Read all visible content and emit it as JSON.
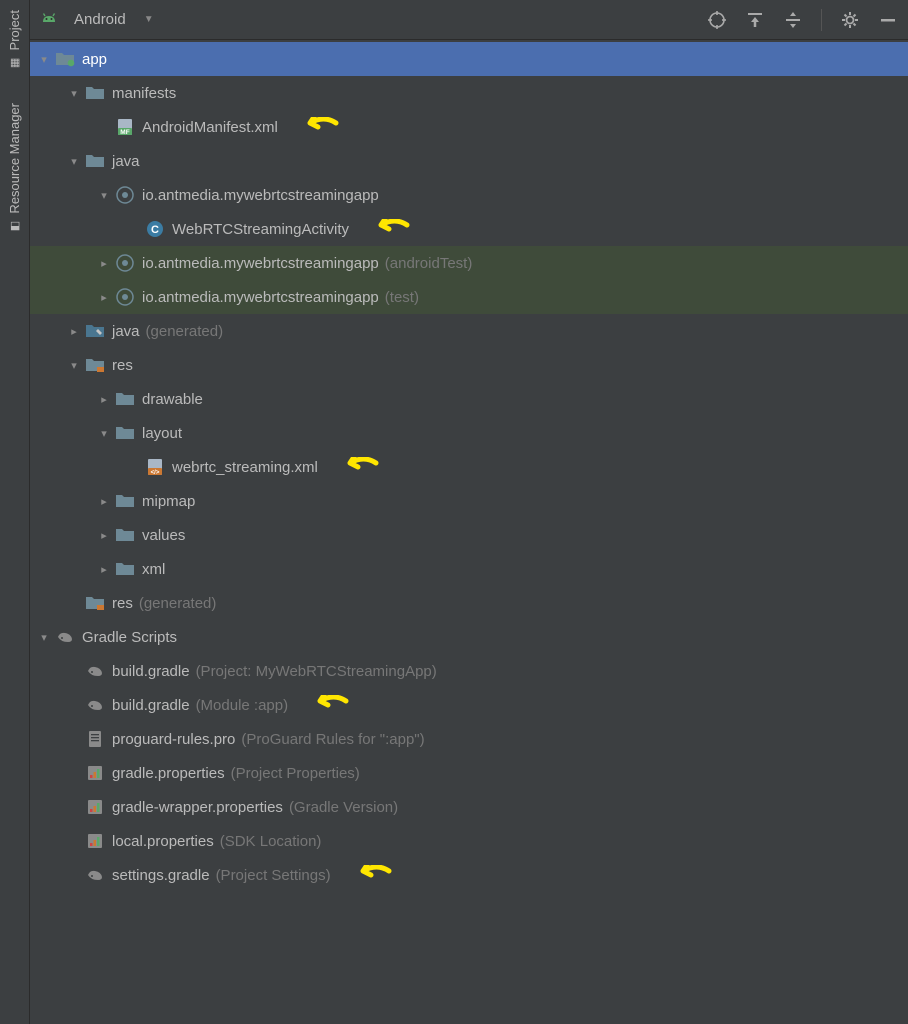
{
  "sideTabs": {
    "project": "Project",
    "resourceManager": "Resource Manager"
  },
  "header": {
    "viewName": "Android"
  },
  "tree": {
    "app": "app",
    "manifests": "manifests",
    "androidManifest": "AndroidManifest.xml",
    "java": "java",
    "pkgMain": "io.antmedia.mywebrtcstreamingapp",
    "activity": "WebRTCStreamingActivity",
    "pkgAndroidTest": "io.antmedia.mywebrtcstreamingapp",
    "pkgAndroidTestSuffix": "(androidTest)",
    "pkgTest": "io.antmedia.mywebrtcstreamingapp",
    "pkgTestSuffix": "(test)",
    "javaGen": "java",
    "javaGenSuffix": "(generated)",
    "res": "res",
    "drawable": "drawable",
    "layout": "layout",
    "layoutFile": "webrtc_streaming.xml",
    "mipmap": "mipmap",
    "values": "values",
    "xml": "xml",
    "resGen": "res",
    "resGenSuffix": "(generated)",
    "gradleScripts": "Gradle Scripts",
    "buildGradleProj": "build.gradle",
    "buildGradleProjSuffix": "(Project: MyWebRTCStreamingApp)",
    "buildGradleMod": "build.gradle",
    "buildGradleModSuffix": "(Module :app)",
    "proguard": "proguard-rules.pro",
    "proguardSuffix": "(ProGuard Rules for \":app\")",
    "gradleProps": "gradle.properties",
    "gradlePropsSuffix": "(Project Properties)",
    "wrapperProps": "gradle-wrapper.properties",
    "wrapperPropsSuffix": "(Gradle Version)",
    "localProps": "local.properties",
    "localPropsSuffix": "(SDK Location)",
    "settingsGradle": "settings.gradle",
    "settingsGradleSuffix": "(Project Settings)"
  },
  "colors": {
    "annotationArrow": "#ffe600"
  }
}
